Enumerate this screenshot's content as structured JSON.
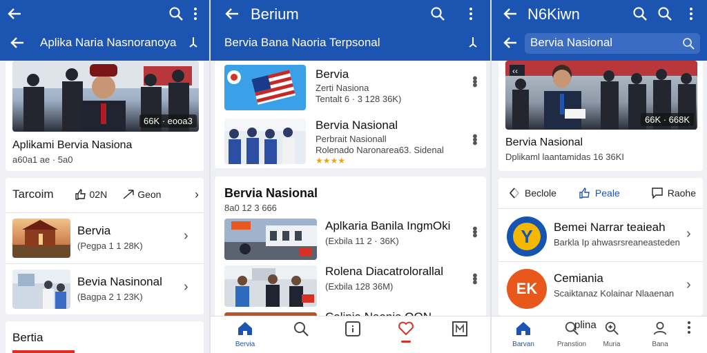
{
  "screens": [
    {
      "subtitle": "Aplika Naria Nasnoranoya",
      "hero": {
        "badge": "66K · eooa3",
        "title": "Aplikami Bervia Nasiona",
        "meta": "a60a1 ae · 5a0"
      },
      "actions": {
        "label": "Tarcoim",
        "like": "02N",
        "share": "Geon"
      },
      "items": [
        {
          "title": "Bervia",
          "meta": "(Pegpa 1 1 28K)"
        },
        {
          "title": "Bevia Nasinonal",
          "meta": "(Bagpa 2 1 23K)"
        }
      ],
      "footer_heading": "Bertia"
    },
    {
      "app_title": "Berium",
      "subtitle": "Bervia Bana Naoria Terpsonal",
      "items": [
        {
          "title": "Bervia",
          "meta1": "Zerti Nasiona",
          "meta2": "Tentalt 6 · 3 128 36K)"
        },
        {
          "title": "Bervia Nasional",
          "meta1": "Perbrait Nasionall",
          "meta2": "Rolenado Naronarea63. Sidenal",
          "stars": "★★★★"
        }
      ],
      "section": {
        "heading": "Bervia Nasional",
        "meta": "8a0 12 3 666"
      },
      "list": [
        {
          "title": "Aplkaria Banila IngmOki",
          "meta": "(Exbila 11 2 · 36K)"
        },
        {
          "title": "Rolena Diacatrolorallal",
          "meta": "(Exbila 128 36M)"
        },
        {
          "title": "Colipia Naonia OON",
          "meta": ""
        }
      ],
      "nav": [
        {
          "icon": "home-icon",
          "label": "Bervia"
        },
        {
          "icon": "search-icon",
          "label": ""
        },
        {
          "icon": "info-icon",
          "label": ""
        },
        {
          "icon": "heart-icon",
          "label": ""
        },
        {
          "icon": "news-icon",
          "label": ""
        }
      ]
    },
    {
      "app_title": "N6Kiwn",
      "search_value": "Bervia Nasional",
      "hero": {
        "badge": "66K · 668K",
        "title": "Bervia Nasional",
        "meta": "Dplikaml laantamidas 16 36KI"
      },
      "actions": {
        "reload": "Beclole",
        "like": "Peale",
        "comment": "Raohe"
      },
      "items": [
        {
          "logo_text": "Y",
          "logo_color": "#1554b0",
          "title": "Bemei Narrar teaieah",
          "meta": "Barkla Ip ahwasrsreaneasteden"
        },
        {
          "logo_text": "EK",
          "logo_color": "#e8571c",
          "title": "Cemiania",
          "meta": "Scaiktanaz Kolainar Nlaaenan"
        }
      ],
      "nav": [
        {
          "icon": "home-icon",
          "label": "Barvan"
        },
        {
          "icon": "search-icon",
          "label": "Pranstion"
        },
        {
          "icon": "search-plus-icon",
          "label": "Muria"
        },
        {
          "icon": "person-icon",
          "label": "Bana"
        },
        {
          "icon": "more-icon",
          "label": ""
        }
      ],
      "nav_overlay": "plina"
    }
  ],
  "colors": {
    "brand": "#1c54b2",
    "accent_red": "#d93025"
  }
}
